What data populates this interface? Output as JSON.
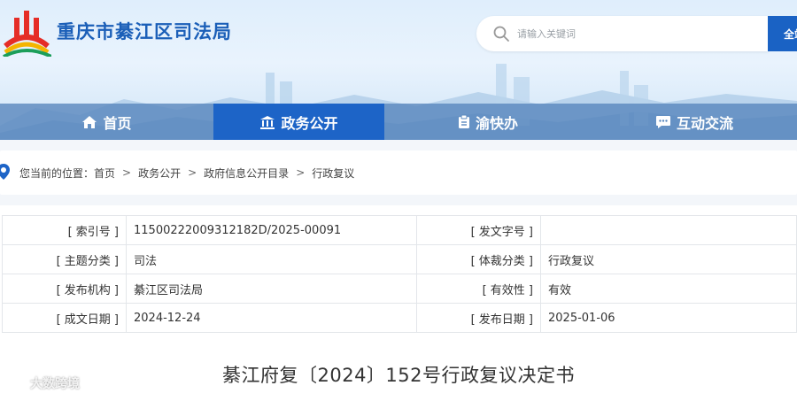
{
  "site": {
    "title": "重庆市綦江区司法局"
  },
  "search": {
    "placeholder": "请输入关键词",
    "button_label": "全站"
  },
  "nav": {
    "items": [
      {
        "label": "首页",
        "icon": "home-icon"
      },
      {
        "label": "政务公开",
        "icon": "government-building-icon",
        "active": true
      },
      {
        "label": "渝快办",
        "icon": "clipboard-icon"
      },
      {
        "label": "互动交流",
        "icon": "chat-bubble-icon"
      }
    ]
  },
  "breadcrumb": {
    "prefix": "您当前的位置：",
    "items": [
      "首页",
      "政务公开",
      "政府信息公开目录",
      "行政复议"
    ],
    "separator": ">"
  },
  "meta": {
    "rows": [
      {
        "label1": "[ 索引号 ]",
        "value1": "11500222009312182D/2025-00091",
        "label2": "[ 发文字号 ]",
        "value2": ""
      },
      {
        "label1": "[ 主题分类 ]",
        "value1": "司法",
        "label2": "[ 体裁分类 ]",
        "value2": "行政复议"
      },
      {
        "label1": "[ 发布机构 ]",
        "value1": "綦江区司法局",
        "label2": "[ 有效性 ]",
        "value2": "有效"
      },
      {
        "label1": "[ 成文日期 ]",
        "value1": "2024-12-24",
        "label2": "[ 发布日期 ]",
        "value2": "2025-01-06"
      }
    ]
  },
  "document": {
    "title": "綦江府复〔2024〕152号行政复议决定书"
  },
  "watermark": {
    "text": "大数跨境"
  },
  "colors": {
    "brand_blue": "#1b5fb8",
    "nav_active": "#1d64c7",
    "nav_bg": "#5b89be"
  }
}
